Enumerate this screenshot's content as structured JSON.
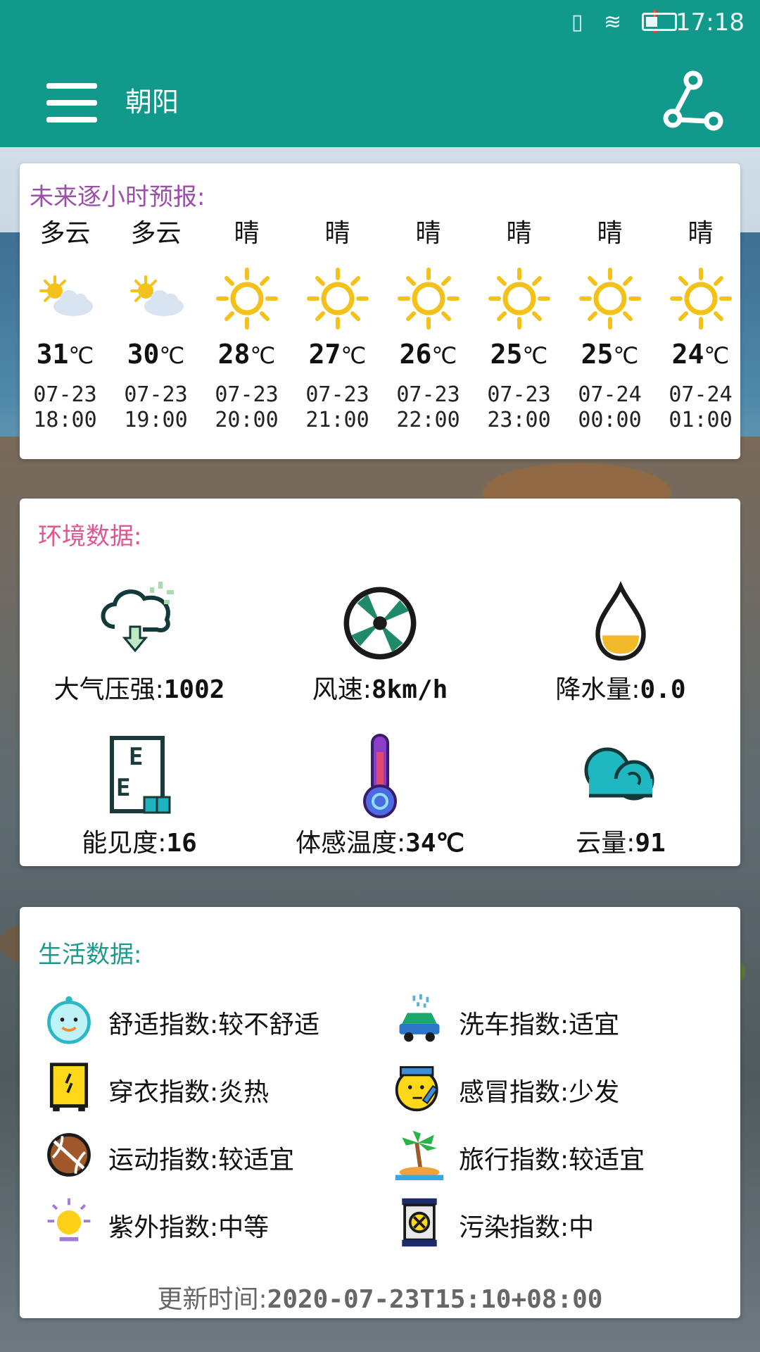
{
  "status_bar": {
    "time": "17:18",
    "icons": [
      "vibrate-icon",
      "wifi-icon",
      "alert-icon",
      "battery-icon"
    ]
  },
  "app_bar": {
    "city": "朝阳"
  },
  "colors": {
    "primary": "#119a8b",
    "hourly_title": "#9b4fa8",
    "env_title": "#e0578f",
    "life_title": "#1b9b8e"
  },
  "hourly": {
    "title": "未来逐小时预报:",
    "items": [
      {
        "cond": "多云",
        "icon": "partly-cloudy-icon",
        "temp": "31",
        "unit": "℃",
        "date": "07-23",
        "time": "18:00"
      },
      {
        "cond": "多云",
        "icon": "partly-cloudy-icon",
        "temp": "30",
        "unit": "℃",
        "date": "07-23",
        "time": "19:00"
      },
      {
        "cond": "晴",
        "icon": "sun-icon",
        "temp": "28",
        "unit": "℃",
        "date": "07-23",
        "time": "20:00"
      },
      {
        "cond": "晴",
        "icon": "sun-icon",
        "temp": "27",
        "unit": "℃",
        "date": "07-23",
        "time": "21:00"
      },
      {
        "cond": "晴",
        "icon": "sun-icon",
        "temp": "26",
        "unit": "℃",
        "date": "07-23",
        "time": "22:00"
      },
      {
        "cond": "晴",
        "icon": "sun-icon",
        "temp": "25",
        "unit": "℃",
        "date": "07-23",
        "time": "23:00"
      },
      {
        "cond": "晴",
        "icon": "sun-icon",
        "temp": "25",
        "unit": "℃",
        "date": "07-24",
        "time": "00:00"
      },
      {
        "cond": "晴",
        "icon": "sun-icon",
        "temp": "24",
        "unit": "℃",
        "date": "07-24",
        "time": "01:00"
      }
    ]
  },
  "environment": {
    "title": "环境数据:",
    "items": [
      {
        "label": "大气压强:",
        "value": "1002",
        "icon": "pressure-cloud-icon"
      },
      {
        "label": "风速:",
        "value": "8km/h",
        "icon": "fan-icon"
      },
      {
        "label": "降水量:",
        "value": "0.0",
        "icon": "water-drop-icon"
      },
      {
        "label": "能见度:",
        "value": "16",
        "icon": "eye-chart-icon"
      },
      {
        "label": "体感温度:",
        "value": "34℃",
        "icon": "thermometer-icon"
      },
      {
        "label": "云量:",
        "value": "91",
        "icon": "cloud-icon"
      }
    ]
  },
  "life": {
    "title": "生活数据:",
    "items": [
      {
        "text": "舒适指数:较不舒适",
        "icon": "comfort-face-icon"
      },
      {
        "text": "洗车指数:适宜",
        "icon": "car-wash-icon"
      },
      {
        "text": "穿衣指数:炎热",
        "icon": "clothing-icon"
      },
      {
        "text": "感冒指数:少发",
        "icon": "cold-face-icon"
      },
      {
        "text": "运动指数:较适宜",
        "icon": "ball-icon"
      },
      {
        "text": "旅行指数:较适宜",
        "icon": "palm-island-icon"
      },
      {
        "text": "紫外指数:中等",
        "icon": "uv-sun-icon"
      },
      {
        "text": "污染指数:中",
        "icon": "pollution-icon"
      }
    ],
    "update_label": "更新时间:",
    "update_value": "2020-07-23T15:10+08:00"
  }
}
